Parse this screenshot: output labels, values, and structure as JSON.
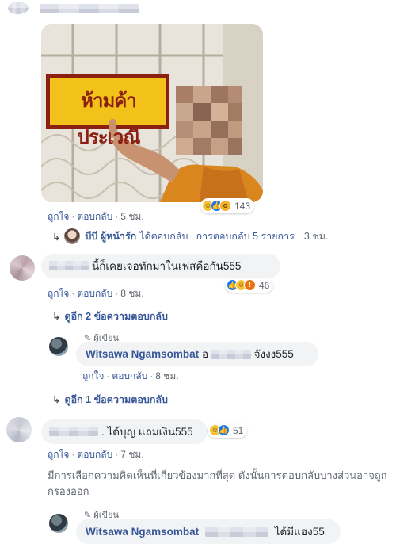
{
  "photo": {
    "sign_text": "ห้ามค้าประเวณี",
    "reactions": {
      "icons": [
        "haha-icon",
        "like-icon",
        "wow-icon"
      ],
      "count": "143"
    }
  },
  "comment1": {
    "actions": {
      "like": "ถูกใจ",
      "reply": "ตอบกลับ",
      "time": "5 ชม."
    },
    "reply_summary": {
      "name": "บีบี ผู้หน้ารัก",
      "text": "ได้ตอบกลับ",
      "count": "การตอบกลับ 5 รายการ",
      "time": "3 ชม."
    }
  },
  "comment2": {
    "text": "นี้ก็เคยเจอทักมาในเฟสคือกัน555",
    "reactions": {
      "icons": [
        "like-icon",
        "haha-icon",
        "angry-icon"
      ],
      "count": "46"
    },
    "actions": {
      "like": "ถูกใจ",
      "reply": "ตอบกลับ",
      "time": "8 ชม."
    },
    "more_replies": "ดูอีก 2 ข้อความตอบกลับ",
    "author_reply": {
      "tag": "ผู้เขียน",
      "name": "Witsawa Ngamsombat",
      "text_prefix": "อ",
      "text": "จังงง555",
      "actions": {
        "like": "ถูกใจ",
        "reply": "ตอบกลับ",
        "time": "8 ชม."
      }
    },
    "more_replies_2": "ดูอีก 1 ข้อความตอบกลับ"
  },
  "comment3": {
    "text": ". ได้บุญ แถมเงิน555",
    "reactions": {
      "icons": [
        "haha-icon",
        "like-icon"
      ],
      "count": "51"
    },
    "actions": {
      "like": "ถูกใจ",
      "reply": "ตอบกลับ",
      "time": "7 ชม."
    },
    "filter_note": "มีการเลือกความคิดเห็นที่เกี่ยวข้องมากที่สุด ดังนั้นการตอบกลับบางส่วนอาจถูกกรองออก",
    "author_reply": {
      "tag": "ผู้เขียน",
      "name": "Witsawa Ngamsombat",
      "text": "ได้มีแฮง55"
    }
  }
}
